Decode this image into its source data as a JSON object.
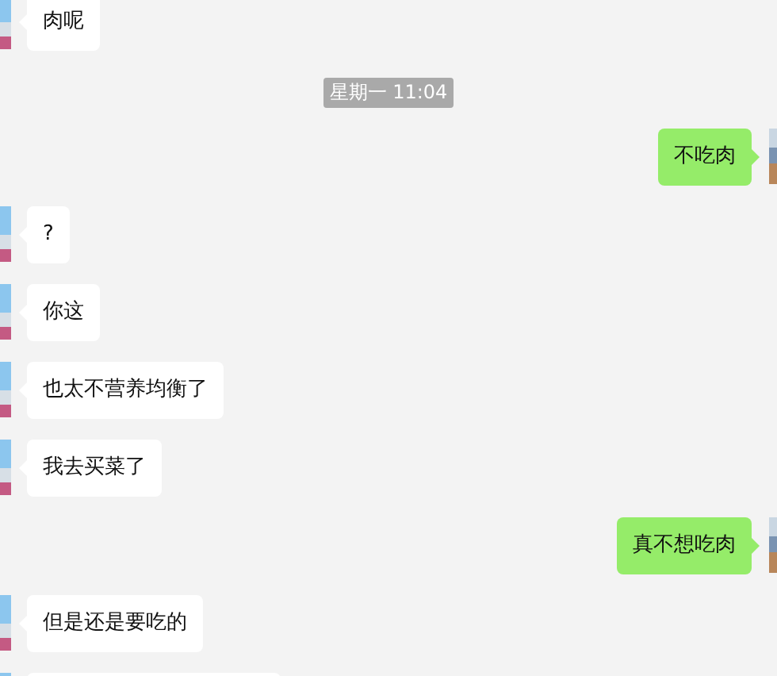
{
  "chat": [
    {
      "kind": "message",
      "outgoing": false,
      "text": "肉呢"
    },
    {
      "kind": "time",
      "text": "星期一 11:04"
    },
    {
      "kind": "message",
      "outgoing": true,
      "text": "不吃肉"
    },
    {
      "kind": "message",
      "outgoing": false,
      "text": "?"
    },
    {
      "kind": "message",
      "outgoing": false,
      "text": "你这"
    },
    {
      "kind": "message",
      "outgoing": false,
      "text": "也太不营养均衡了"
    },
    {
      "kind": "message",
      "outgoing": false,
      "text": "我去买菜了"
    },
    {
      "kind": "message",
      "outgoing": true,
      "text": "真不想吃肉"
    },
    {
      "kind": "message",
      "outgoing": false,
      "text": "但是还是要吃的"
    },
    {
      "kind": "cut_off",
      "outgoing": false
    }
  ]
}
